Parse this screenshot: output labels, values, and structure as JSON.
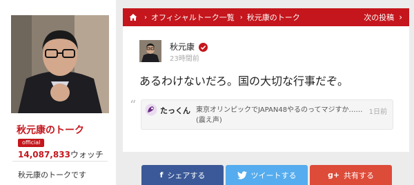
{
  "profile": {
    "name": "秋元康のトーク",
    "badge": "official",
    "watch_count": "14,087,833",
    "watch_unit": "ウォッチ",
    "description": "秋元康のトークです"
  },
  "breadcrumb": {
    "items": [
      "オフィシャルトーク一覧",
      "秋元康のトーク"
    ],
    "separator": "›",
    "next_label": "次の投稿",
    "next_chevron": "›"
  },
  "post": {
    "author": "秋元康",
    "time": "23時間前",
    "body": "あるわけないだろ。国の大切な行事だぞ。",
    "reply": {
      "quote_mark": "“",
      "user": "たっくん",
      "text": "東京オリンピックでJAPAN48やるのってマジすか……(震え声)",
      "time": "1日前"
    }
  },
  "share": {
    "facebook_icon": "f",
    "facebook_label": "シェアする",
    "twitter_label": "ツイートする",
    "googleplus_icon": "g+",
    "googleplus_label": "共有する"
  },
  "colors": {
    "accent": "#c4161c",
    "facebook": "#3b5998",
    "twitter": "#55acee",
    "googleplus": "#dd4b39"
  }
}
